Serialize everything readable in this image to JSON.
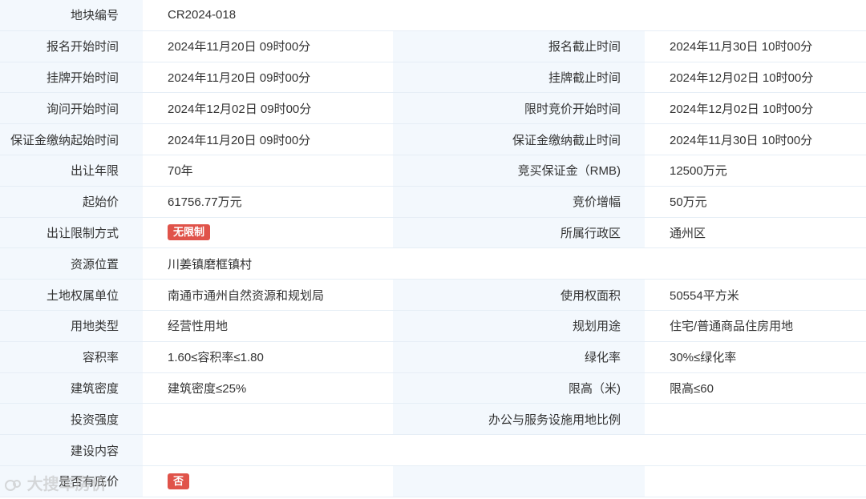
{
  "rows": [
    {
      "l1": "地块编号",
      "v1": "CR2024-018",
      "span": true
    },
    {
      "l1": "报名开始时间",
      "v1": "2024年11月20日 09时00分",
      "l2": "报名截止时间",
      "v2": "2024年11月30日 10时00分"
    },
    {
      "l1": "挂牌开始时间",
      "v1": "2024年11月20日 09时00分",
      "l2": "挂牌截止时间",
      "v2": "2024年12月02日 10时00分"
    },
    {
      "l1": "询问开始时间",
      "v1": "2024年12月02日 09时00分",
      "l2": "限时竞价开始时间",
      "v2": "2024年12月02日 10时00分"
    },
    {
      "l1": "保证金缴纳起始时间",
      "v1": "2024年11月20日 09时00分",
      "l2": "保证金缴纳截止时间",
      "v2": "2024年11月30日 10时00分"
    },
    {
      "l1": "出让年限",
      "v1": "70年",
      "l2": "竞买保证金（RMB)",
      "v2": "12500万元"
    },
    {
      "l1": "起始价",
      "v1": "61756.77万元",
      "l2": "竞价增幅",
      "v2": "50万元"
    },
    {
      "l1": "出让限制方式",
      "badge1": "无限制",
      "l2": "所属行政区",
      "v2": "通州区"
    },
    {
      "l1": "资源位置",
      "v1": "川姜镇磨框镇村",
      "span": true
    },
    {
      "l1": "土地权属单位",
      "v1": "南通市通州自然资源和规划局",
      "l2": "使用权面积",
      "v2": "50554平方米"
    },
    {
      "l1": "用地类型",
      "v1": "经营性用地",
      "l2": "规划用途",
      "v2": "住宅/普通商品住房用地"
    },
    {
      "l1": "容积率",
      "v1": "1.60≤容积率≤1.80",
      "l2": "绿化率",
      "v2": "30%≤绿化率"
    },
    {
      "l1": "建筑密度",
      "v1": "建筑密度≤25%",
      "l2": "限高（米)",
      "v2": "限高≤60"
    },
    {
      "l1": "投资强度",
      "v1": "",
      "l2": "办公与服务设施用地比例",
      "v2": ""
    },
    {
      "l1": "建设内容",
      "v1": "",
      "span": true
    },
    {
      "l1": "是否有底价",
      "badge1": "否",
      "l2": "",
      "v2": ""
    }
  ],
  "watermark": "大搜车房价",
  "colors": {
    "label_bg": "#f3f8fd",
    "badge": "#e0534a",
    "border": "#e6eef6"
  }
}
